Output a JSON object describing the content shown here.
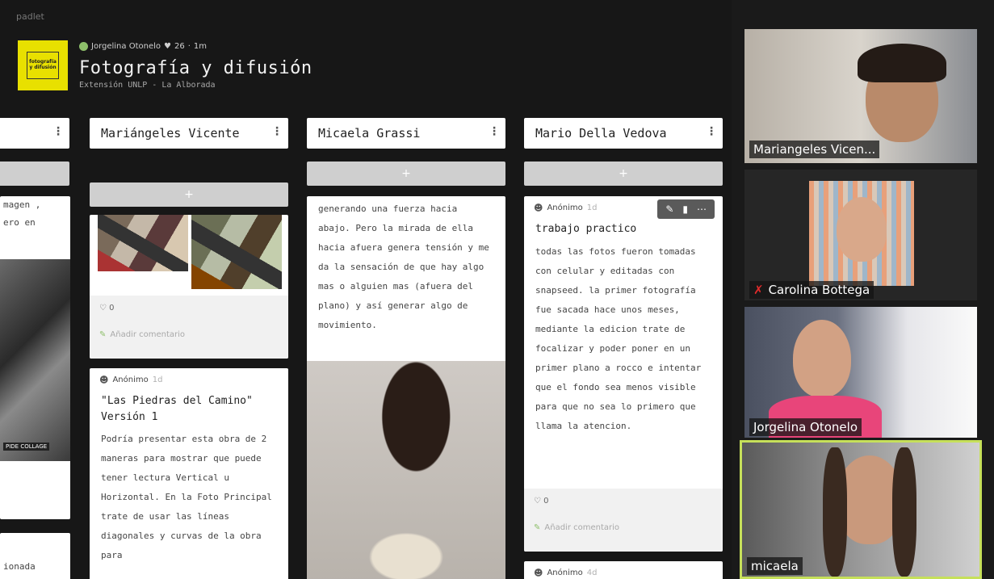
{
  "padlet": {
    "brand": "padlet",
    "logo_text": "fotografía y difusión",
    "meta": {
      "author": "Jorgelina Otonelo",
      "likes": "26",
      "time": "1m"
    },
    "title": "Fotografía y difusión",
    "subtitle": "Extensión UNLP - La Alborada",
    "add_label": "+",
    "menu_icon": "⋮",
    "columns": [
      {
        "name": ""
      },
      {
        "name": "Mariángeles Vicente"
      },
      {
        "name": "Micaela Grassi"
      },
      {
        "name": "Mario Della Vedova"
      }
    ],
    "col0_snippets": {
      "line1": "magen ,",
      "line2": "ero en",
      "collage_label": "PIDE COLLAGE",
      "bottom": "ionada"
    },
    "posts": {
      "marianageles_first": {
        "likes": "0",
        "comment": "Añadir comentario"
      },
      "piedras": {
        "author": "Anónimo",
        "time": "1d",
        "title": "\"Las Piedras del Camino\" Versión 1",
        "body": "Podría presentar esta obra de 2 maneras para mostrar que puede tener lectura Vertical u Horizontal. En la Foto Principal trate de usar las líneas diagonales y curvas de la obra para"
      },
      "micaela_text": {
        "body": "generando una fuerza hacia abajo. Pero la mirada de ella hacia afuera genera tensión y me da la sensación de que hay algo mas o alguien mas (afuera del plano) y así generar algo de movimiento."
      },
      "trabajo": {
        "author": "Anónimo",
        "time": "1d",
        "title": "trabajo practico",
        "body": "todas las fotos fueron tomadas con celular y editadas con snapseed. la primer fotografía fue sacada hace unos meses, mediante la edicion trate de focalizar y poder poner en un primer plano a rocco e intentar que el fondo sea menos visible para que no sea lo primero que llama la atencion.",
        "likes": "0",
        "comment": "Añadir comentario"
      },
      "mario_second": {
        "author": "Anónimo",
        "time": "4d"
      }
    }
  },
  "video": {
    "participants": [
      {
        "name": "Mariangeles Vicen...",
        "muted": false,
        "active": false
      },
      {
        "name": "Carolina Bottega",
        "muted": true,
        "active": false
      },
      {
        "name": "Jorgelina Otonelo",
        "muted": false,
        "active": false
      },
      {
        "name": "micaela",
        "muted": false,
        "active": true
      }
    ]
  },
  "colors": {
    "accent_yellow": "#e8e000",
    "active_speaker": "#c6e05a",
    "mute_red": "#e02b2b"
  }
}
